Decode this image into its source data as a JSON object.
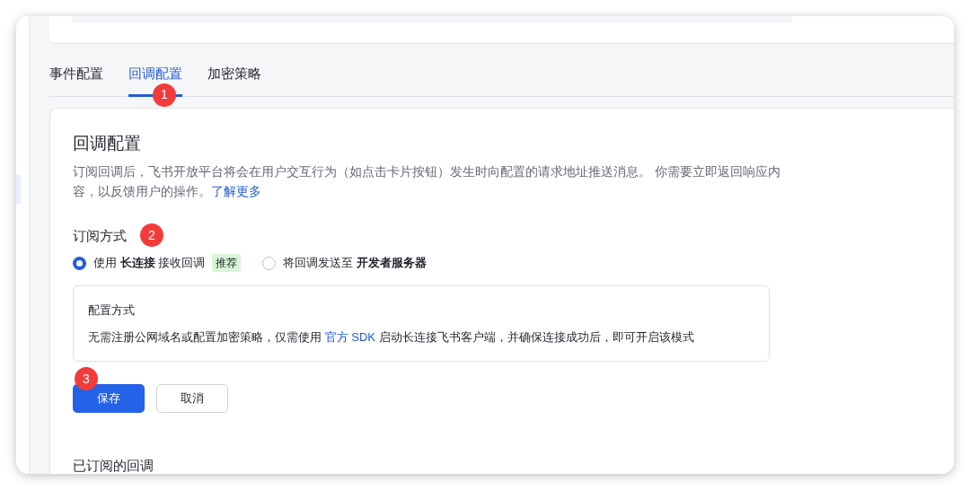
{
  "tabs": [
    {
      "label": "事件配置",
      "selected": false
    },
    {
      "label": "回调配置",
      "selected": true,
      "step": "1"
    },
    {
      "label": "加密策略",
      "selected": false
    }
  ],
  "panel": {
    "title": "回调配置",
    "description": "订阅回调后，飞书开放平台将会在用户交互行为（如点击卡片按钮）发生时向配置的请求地址推送消息。 你需要立即返回响应内容，以反馈用户的操作。",
    "link": "了解更多"
  },
  "subscription": {
    "label": "订阅方式",
    "step": "2",
    "options": [
      {
        "selected": true,
        "text": "使用 **长连接** 接收回调",
        "tag": "推荐"
      },
      {
        "selected": false,
        "text": "将回调发送至 **开发者服务器**"
      }
    ]
  },
  "config_box": {
    "title": "配置方式",
    "text_before": "无需注册公网域名或配置加密策略，仅需使用 ",
    "link": "官方 SDK",
    "text_after": " 启动长连接飞书客户端，并确保连接成功后，即可开启该模式"
  },
  "buttons": [
    {
      "kind": "primary",
      "label": "保存",
      "step": "3"
    },
    {
      "kind": "default",
      "label": "取消"
    }
  ],
  "subscribed_heading": "已订阅的回调"
}
